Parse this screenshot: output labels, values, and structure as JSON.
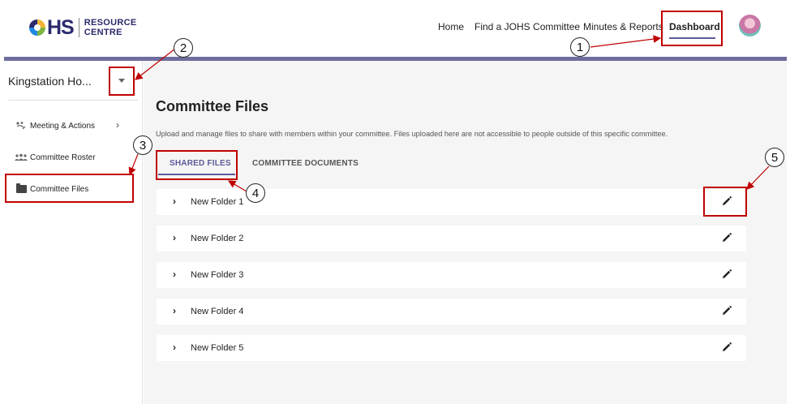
{
  "logo": {
    "brand": "HS",
    "line1": "RESOURCE",
    "line2": "CENTRE"
  },
  "nav": {
    "home": "Home",
    "find": "Find a JOHS Committee",
    "minutes": "Minutes & Reports",
    "dashboard": "Dashboard"
  },
  "sidebar": {
    "site_name": "Kingstation Ho...",
    "items": [
      {
        "label": "Meeting & Actions",
        "icon": "meeting-icon"
      },
      {
        "label": "Committee Roster",
        "icon": "people-icon"
      },
      {
        "label": "Committee Files",
        "icon": "folder-icon"
      }
    ]
  },
  "main": {
    "title": "Committee Files",
    "description": "Upload and manage files to share with members within your committee. Files uploaded here are not accessible to people outside of this specific committee.",
    "tabs": [
      {
        "label": "SHARED FILES",
        "active": true
      },
      {
        "label": "COMMITTEE DOCUMENTS",
        "active": false
      }
    ],
    "folders": [
      {
        "name": "New Folder 1"
      },
      {
        "name": "New Folder 2"
      },
      {
        "name": "New Folder 3"
      },
      {
        "name": "New Folder 4"
      },
      {
        "name": "New Folder 5"
      }
    ]
  },
  "annotations": [
    "1",
    "2",
    "3",
    "4",
    "5"
  ],
  "colors": {
    "accent": "#5c5a9a",
    "topbar": "#6e6d9d",
    "annotation": "#c00000",
    "brand": "#2b2a6d"
  }
}
